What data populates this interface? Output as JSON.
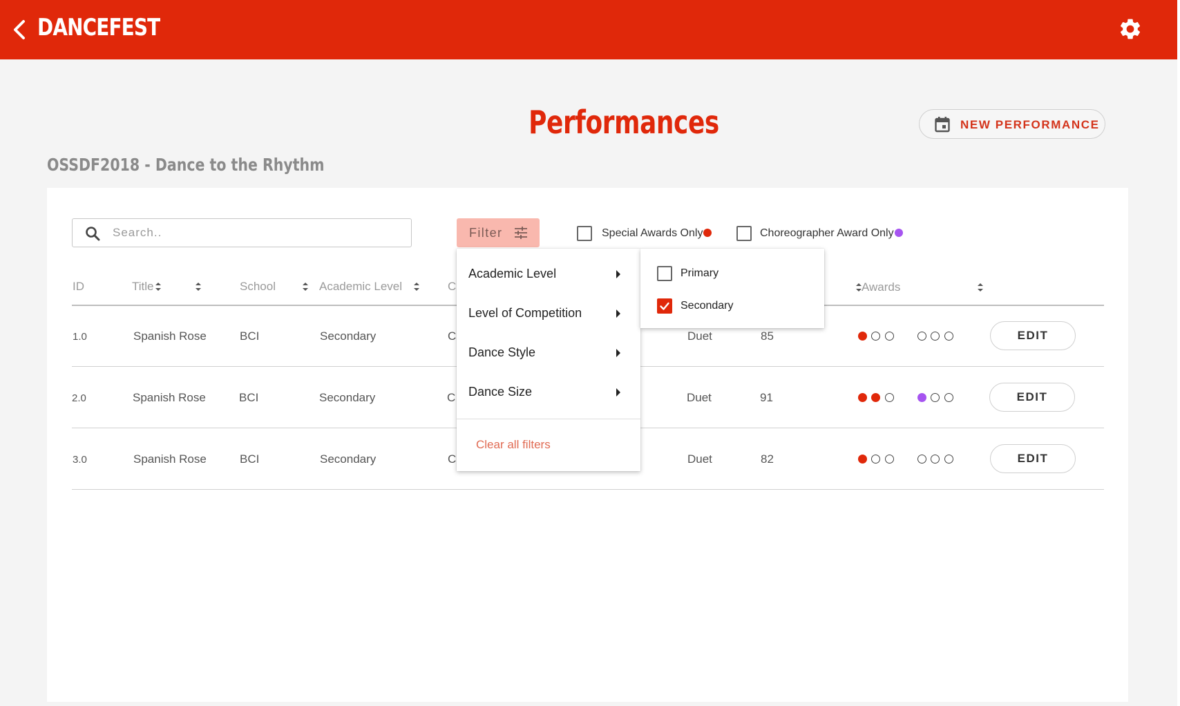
{
  "app": {
    "title": "DANCEFEST",
    "brand_color": "#e0280a"
  },
  "header": {
    "back_icon": "chevron-left-icon",
    "settings_icon": "gear-icon"
  },
  "page": {
    "title": "Performances",
    "event_name": "OSSDF2018 - Dance to the Rhythm",
    "new_performance_label": "NEW PERFORMANCE",
    "new_performance_icon": "calendar-icon"
  },
  "toolbar": {
    "search_placeholder": "Search..",
    "filter_label": "Filter",
    "filter_icon": "sliders-icon",
    "special_awards_label": "Special Awards Only",
    "special_awards_checked": false,
    "special_awards_color": "#e0280a",
    "choreographer_label": "Choreographer Award Only",
    "choreographer_checked": false,
    "choreographer_color": "#a654f0"
  },
  "table": {
    "columns": {
      "id": "ID",
      "title": "Title",
      "school": "School",
      "academic_level": "Academic Level",
      "competition_partial": "C",
      "awards": "Awards"
    },
    "rows": [
      {
        "id": "1.0",
        "title": "Spanish Rose",
        "school": "BCI",
        "academic_level": "Secondary",
        "competition_partial": "C",
        "size": "Duet",
        "score": "85",
        "special_awards": [
          "filled",
          "empty",
          "empty"
        ],
        "choreo_awards": [
          "empty",
          "empty",
          "empty"
        ],
        "edit_label": "EDIT"
      },
      {
        "id": "2.0",
        "title": "Spanish Rose",
        "school": "BCI",
        "academic_level": "Secondary",
        "competition_partial": "C",
        "size": "Duet",
        "score": "91",
        "special_awards": [
          "filled",
          "filled",
          "empty"
        ],
        "choreo_awards": [
          "filled",
          "empty",
          "empty"
        ],
        "edit_label": "EDIT"
      },
      {
        "id": "3.0",
        "title": "Spanish Rose",
        "school": "BCI",
        "academic_level": "Secondary",
        "competition_partial": "C",
        "size": "Duet",
        "score": "82",
        "special_awards": [
          "filled",
          "empty",
          "empty"
        ],
        "choreo_awards": [
          "empty",
          "empty",
          "empty"
        ],
        "edit_label": "EDIT"
      }
    ]
  },
  "filter_menu": {
    "items": [
      {
        "label": "Academic Level"
      },
      {
        "label": "Level of Competition"
      },
      {
        "label": "Dance Style"
      },
      {
        "label": "Dance Size"
      }
    ],
    "clear_label": "Clear all filters"
  },
  "academic_submenu": {
    "options": [
      {
        "label": "Primary",
        "checked": false
      },
      {
        "label": "Secondary",
        "checked": true
      }
    ]
  }
}
